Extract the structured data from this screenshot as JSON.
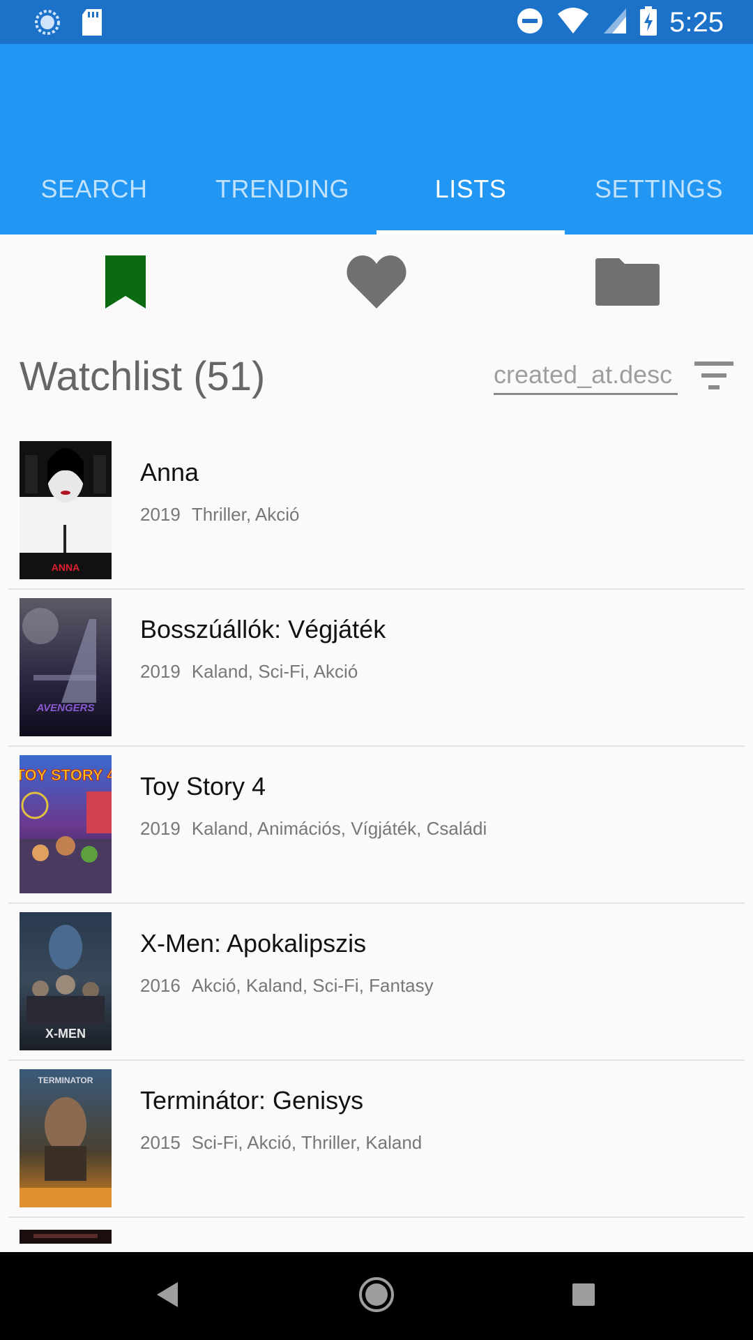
{
  "status_bar": {
    "time": "5:25",
    "icons": [
      "sync-icon",
      "sd-card-icon",
      "do-not-disturb-icon",
      "wifi-icon",
      "signal-icon",
      "battery-charging-icon"
    ]
  },
  "tabs": [
    {
      "label": "SEARCH",
      "active": false
    },
    {
      "label": "TRENDING",
      "active": false
    },
    {
      "label": "LISTS",
      "active": true
    },
    {
      "label": "SETTINGS",
      "active": false
    }
  ],
  "list_icons": [
    {
      "name": "bookmark-icon",
      "color": "#0a6b10",
      "active": true
    },
    {
      "name": "heart-icon",
      "color": "#707070",
      "active": false
    },
    {
      "name": "folder-icon",
      "color": "#707070",
      "active": false
    }
  ],
  "header": {
    "title": "Watchlist (51)",
    "sort_value": "created_at.desc"
  },
  "movies": [
    {
      "title": "Anna",
      "year": "2019",
      "genres": "Thriller, Akció",
      "poster_text": "ANNA"
    },
    {
      "title": "Bosszúállók: Végjáték",
      "year": "2019",
      "genres": "Kaland, Sci-Fi, Akció",
      "poster_text": ""
    },
    {
      "title": "Toy Story 4",
      "year": "2019",
      "genres": "Kaland, Animációs, Vígjáték, Családi",
      "poster_text": "TOY STORY 4"
    },
    {
      "title": "X-Men: Apokalipszis",
      "year": "2016",
      "genres": "Akció, Kaland, Sci-Fi, Fantasy",
      "poster_text": "X-MEN"
    },
    {
      "title": "Terminátor: Genisys",
      "year": "2015",
      "genres": "Sci-Fi, Akció, Thriller, Kaland",
      "poster_text": "TERMINATOR"
    }
  ],
  "colors": {
    "status_bar": "#1c72c9",
    "app_bar": "#2196f3",
    "active_list": "#0a6b10"
  }
}
